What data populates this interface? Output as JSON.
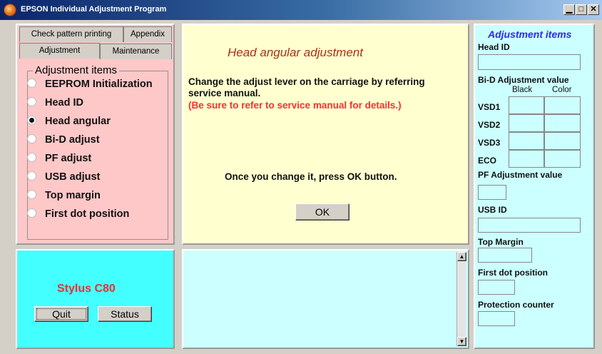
{
  "window": {
    "title": "EPSON Individual Adjustment Program",
    "minimize_icon": "minimize-icon",
    "maximize_icon": "maximize-icon",
    "close_icon": "close-icon"
  },
  "tabs": {
    "row1": [
      "Check pattern printing",
      "Appendix"
    ],
    "row2": [
      "Adjustment",
      "Maintenance"
    ],
    "selected": "Adjustment"
  },
  "adjustment_group": {
    "title": "Adjustment items",
    "options": [
      "EEPROM Initialization",
      "Head ID",
      "Head angular",
      "Bi-D adjust",
      "PF adjust",
      "USB adjust",
      "Top margin",
      "First dot position"
    ],
    "selected": "Head angular"
  },
  "main": {
    "heading": "Head angular adjustment",
    "instruction": "Change the adjust lever on the carriage by referring service manual.",
    "warning": "(Be sure to refer to service manual for details.)",
    "prompt": "Once you change it, press OK button.",
    "ok_label": "OK"
  },
  "bottom_left": {
    "model": "Stylus C80",
    "quit_label": "Quit",
    "status_label": "Status"
  },
  "right": {
    "title": "Adjustment items",
    "head_id_label": "Head ID",
    "bid_label": "Bi-D Adjustment value",
    "col_black": "Black",
    "col_color": "Color",
    "rows": [
      "VSD1",
      "VSD2",
      "VSD3",
      "ECO"
    ],
    "pf_label": "PF Adjustment value",
    "usb_label": "USB ID",
    "top_margin_label": "Top Margin",
    "first_dot_label": "First dot position",
    "protection_label": "Protection counter"
  },
  "colors": {
    "left_panel": "#ffc8c8",
    "center_panel": "#ffffd0",
    "right_panel": "#ccffff",
    "model_panel": "#44ffff",
    "heading": "#b03010",
    "warning": "#ff3030",
    "accent_title": "#2a2aee"
  }
}
